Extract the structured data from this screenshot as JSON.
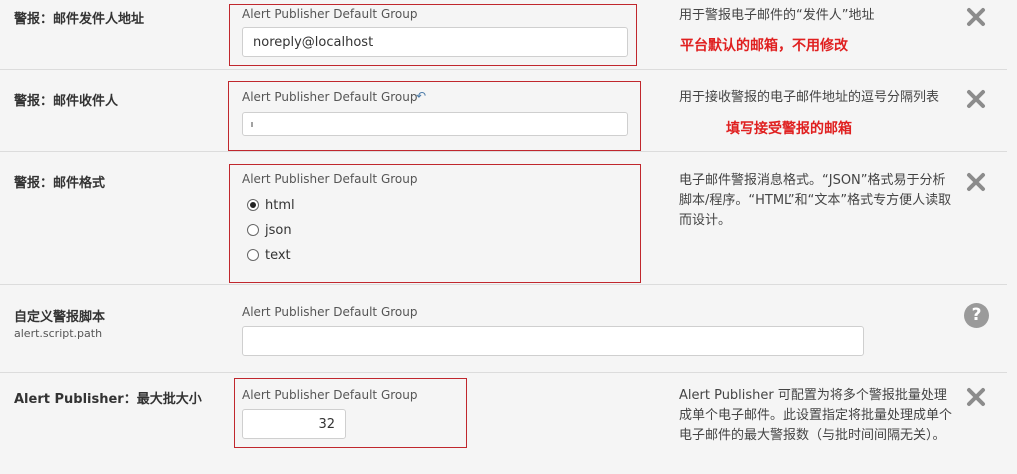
{
  "rows": [
    {
      "label": "警报：邮件发件人地址",
      "group": "Alert Publisher Default Group",
      "value": "noreply@localhost",
      "description": "用于警报电子邮件的“发件人”地址",
      "annotation": "平台默认的邮箱，不用修改"
    },
    {
      "label": "警报：邮件收件人",
      "group": "Alert Publisher Default Group",
      "value": "",
      "description": "用于接收警报的电子邮件地址的逗号分隔列表",
      "annotation": "填写接受警报的邮箱"
    },
    {
      "label": "警报：邮件格式",
      "group": "Alert Publisher Default Group",
      "options": [
        "html",
        "json",
        "text"
      ],
      "selected": "html",
      "description": "电子邮件警报消息格式。“JSON”格式易于分析脚本/程序。“HTML”和“文本”格式专方便人读取而设计。"
    },
    {
      "label": "自定义警报脚本",
      "sublabel": "alert.script.path",
      "group": "Alert Publisher Default Group",
      "value": ""
    },
    {
      "label": "Alert Publisher：最大批大小",
      "group": "Alert Publisher Default Group",
      "value": "32",
      "description": "Alert Publisher 可配置为将多个警报批量处理成单个电子邮件。此设置指定将批量处理成单个电子邮件的最大警报数（与批时间间隔无关）。"
    }
  ],
  "icons": {
    "remove": "close-icon",
    "help": "question-circle-icon",
    "undo": "undo-arrow-icon"
  },
  "colors": {
    "annotation": "#e02020",
    "annotation_box": "#c0272d",
    "background": "#f5f5f5"
  }
}
